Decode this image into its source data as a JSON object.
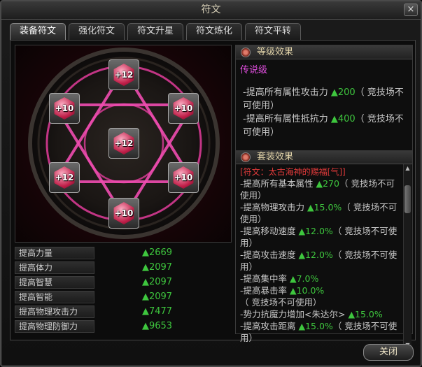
{
  "window": {
    "title": "符文",
    "close_symbol": "×"
  },
  "tabs": [
    {
      "label": "装备符文",
      "active": true
    },
    {
      "label": "强化符文",
      "active": false
    },
    {
      "label": "符文升星",
      "active": false
    },
    {
      "label": "符文炼化",
      "active": false
    },
    {
      "label": "符文平转",
      "active": false
    }
  ],
  "runes": [
    {
      "slot": "top",
      "level": "+12"
    },
    {
      "slot": "upper-left",
      "level": "+10"
    },
    {
      "slot": "upper-right",
      "level": "+10"
    },
    {
      "slot": "center",
      "level": "+12"
    },
    {
      "slot": "lower-left",
      "level": "+12"
    },
    {
      "slot": "lower-right",
      "level": "+10"
    },
    {
      "slot": "bottom",
      "level": "+10"
    }
  ],
  "stats": [
    {
      "label": "提高力量",
      "value": "▲2669"
    },
    {
      "label": "提高体力",
      "value": "▲2097"
    },
    {
      "label": "提高智慧",
      "value": "▲2097"
    },
    {
      "label": "提高智能",
      "value": "▲2097"
    },
    {
      "label": "提高物理攻击力",
      "value": "▲7477"
    },
    {
      "label": "提高物理防御力",
      "value": "▲9653"
    }
  ],
  "level_effect": {
    "header": "等级效果",
    "grade": "传说级",
    "lines": [
      {
        "prefix": "-提高所有属性攻击力 ",
        "value": "▲200",
        "suffix": "（ 竞技场不可使用）"
      },
      {
        "prefix": "-提高所有属性抵抗力 ",
        "value": "▲400",
        "suffix": "（ 竞技场不可使用）"
      }
    ]
  },
  "set_effect": {
    "header": "套装效果",
    "title": "[符文：太古海神的赐福[气]]",
    "lines": [
      {
        "prefix": "-提高所有基本属性 ",
        "value": "▲270",
        "suffix": "（ 竞技场不可使用）"
      },
      {
        "prefix": "-提高物理攻击力 ",
        "value": "▲15.0%",
        "suffix": "（ 竞技场不可使用）"
      },
      {
        "prefix": "-提高移动速度 ",
        "value": "▲12.0%",
        "suffix": "（ 竞技场不可使用）"
      },
      {
        "prefix": "-提高攻击速度 ",
        "value": "▲12.0%",
        "suffix": "（ 竞技场不可使用）"
      },
      {
        "prefix": "-提高集中率 ",
        "value": "▲7.0%",
        "suffix": ""
      },
      {
        "prefix": "-提高暴击率 ",
        "value": "▲10.0%",
        "suffix": "（ 竞技场不可使用）"
      },
      {
        "prefix": "-势力抗魔力增加<朱达尔> ",
        "value": "▲15.0%",
        "suffix": ""
      },
      {
        "prefix": "-提高攻击距离 ",
        "value": "▲15.0%",
        "suffix": "（ 竞技场不可使用）"
      }
    ]
  },
  "footer": {
    "close_label": "关闭"
  },
  "colors": {
    "accent_pink": "#e03c9a",
    "value_green": "#3ec63e",
    "grade_purple": "#e24fe0",
    "set_red": "#e03a3a"
  }
}
